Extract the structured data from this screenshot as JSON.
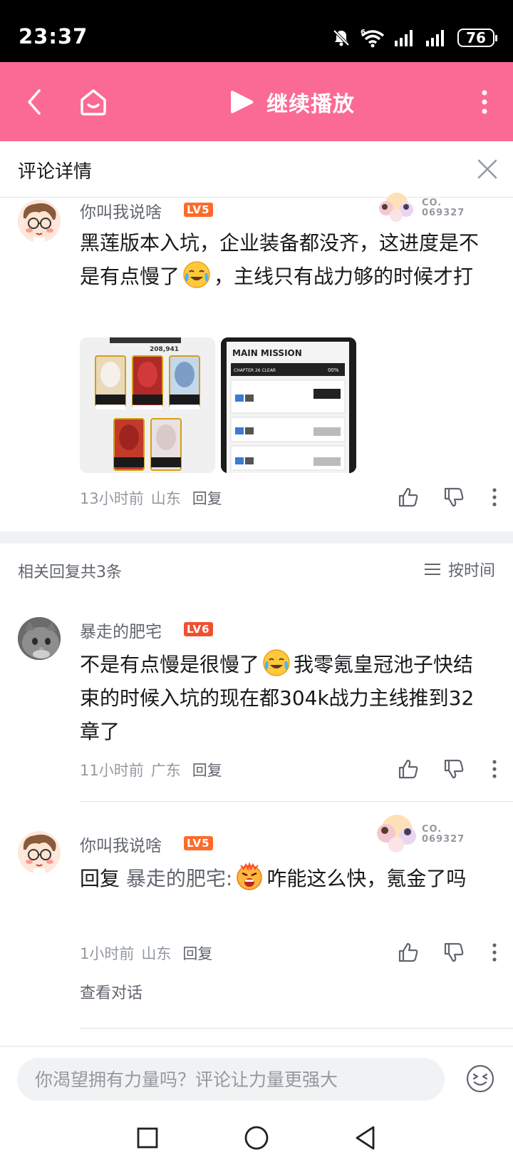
{
  "status_bar": {
    "time": "23:37",
    "battery": "76"
  },
  "header": {
    "play_label": "继续播放"
  },
  "detail": {
    "title": "评论详情"
  },
  "root_comment": {
    "username": "你叫我说啥",
    "level": "LV5",
    "badge_number": "069327",
    "content_part1": "黑莲版本入坑，企业装备都没齐，这进度是不是有点慢了",
    "content_part2": "，主线只有战力够的时候才打",
    "image1_power": "208,941",
    "image2_title": "MAIN MISSION",
    "image2_sub": "CHAPTER 26 CLEAR",
    "image2_progress": "00%",
    "time": "13小时前",
    "location": "山东",
    "reply_label": "回复"
  },
  "related": {
    "count_label": "相关回复共3条",
    "sort_label": "按时间"
  },
  "replies": [
    {
      "username": "暴走的肥宅",
      "level": "LV6",
      "content_part1": "不是有点慢是很慢了",
      "content_part2": "我零氪皇冠池子快结束的时候入坑的现在都304k战力主线推到32章了",
      "time": "11小时前",
      "location": "广东",
      "reply_label": "回复"
    },
    {
      "username": "你叫我说啥",
      "level": "LV5",
      "badge_number": "069327",
      "reply_prefix": "回复 ",
      "reply_target": "暴走的肥宅:",
      "content_part2": "咋能这么快，氪金了吗",
      "time": "1小时前",
      "location": "山东",
      "reply_label": "回复",
      "view_conversation": "查看对话"
    }
  ],
  "input": {
    "placeholder": "你渴望拥有力量吗？评论让力量更强大"
  },
  "colors": {
    "brand_pink": "#fb6a94",
    "level_orange": "#ff6b2b",
    "text_gray": "#9499a0"
  }
}
